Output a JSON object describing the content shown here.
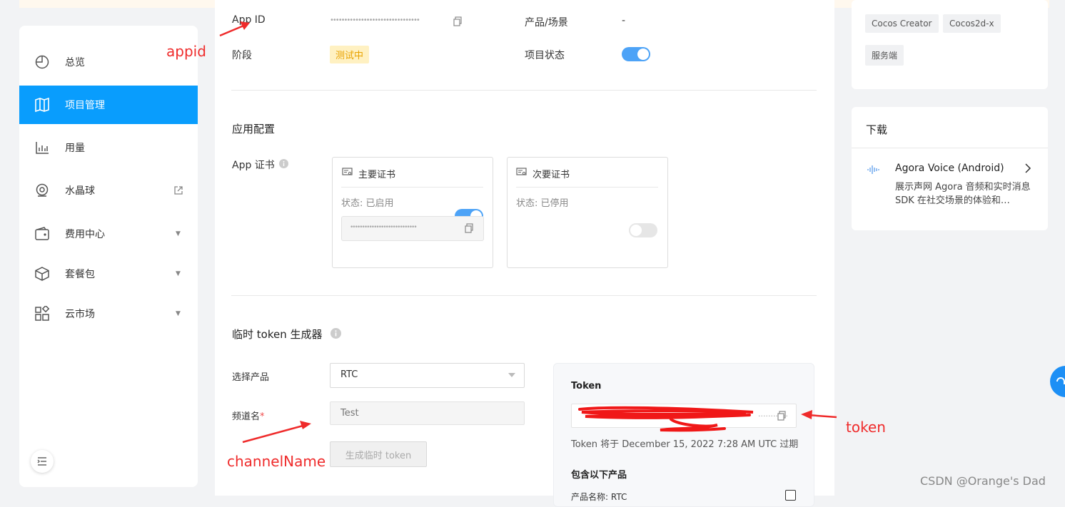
{
  "sidebar": {
    "items": [
      {
        "label": "总览",
        "icon": "overview-icon"
      },
      {
        "label": "项目管理",
        "icon": "project-map-icon",
        "active": true
      },
      {
        "label": "用量",
        "icon": "usage-chart-icon"
      },
      {
        "label": "水晶球",
        "icon": "crystal-ball-icon",
        "external": true
      },
      {
        "label": "费用中心",
        "icon": "wallet-icon",
        "expandable": true
      },
      {
        "label": "套餐包",
        "icon": "package-icon",
        "expandable": true
      },
      {
        "label": "云市场",
        "icon": "marketplace-icon",
        "expandable": true
      }
    ]
  },
  "project": {
    "app_id_label": "App ID",
    "app_id_value": "••••••••••••••••••••••••••••••••",
    "product_label": "产品/场景",
    "product_value": "-",
    "stage_label": "阶段",
    "stage_value": "测试中",
    "status_label": "项目状态",
    "status_on": true
  },
  "app_config": {
    "title": "应用配置",
    "cert_label": "App 证书",
    "primary": {
      "title": "主要证书",
      "status": "状态: 已启用",
      "enabled": true,
      "value": "••••••••••••••••••••••••••••"
    },
    "secondary": {
      "title": "次要证书",
      "status": "状态: 已停用",
      "enabled": false
    }
  },
  "token_gen": {
    "title": "临时 token 生成器",
    "product_label": "选择产品",
    "product_value": "RTC",
    "channel_label": "频道名",
    "required_mark": "*",
    "channel_placeholder": "Test",
    "generate_button": "生成临时 token",
    "token_title": "Token",
    "token_value": "............",
    "expire_text": "Token 将于 December 15, 2022 7:28 AM UTC 过期",
    "includes_title": "包含以下产品",
    "includes_first": "产品名称: RTC"
  },
  "right": {
    "chips": [
      "Cocos Creator",
      "Cocos2d-x",
      "服务端"
    ],
    "download_title": "下载",
    "download_item_title": "Agora Voice (Android)",
    "download_item_desc": "展示声网 Agora 音频和实时消息 SDK 在社交场景的体验和…"
  },
  "annotations": {
    "appid": "appid",
    "channelName": "channelName",
    "token": "token",
    "color": "#ef2b2b"
  },
  "watermark": "CSDN @Orange's Dad",
  "colors": {
    "accent": "#099dfd",
    "switch_on": "#4da3f7",
    "testing_tag_bg": "#fff1c2",
    "testing_tag_fg": "#e8a200"
  }
}
